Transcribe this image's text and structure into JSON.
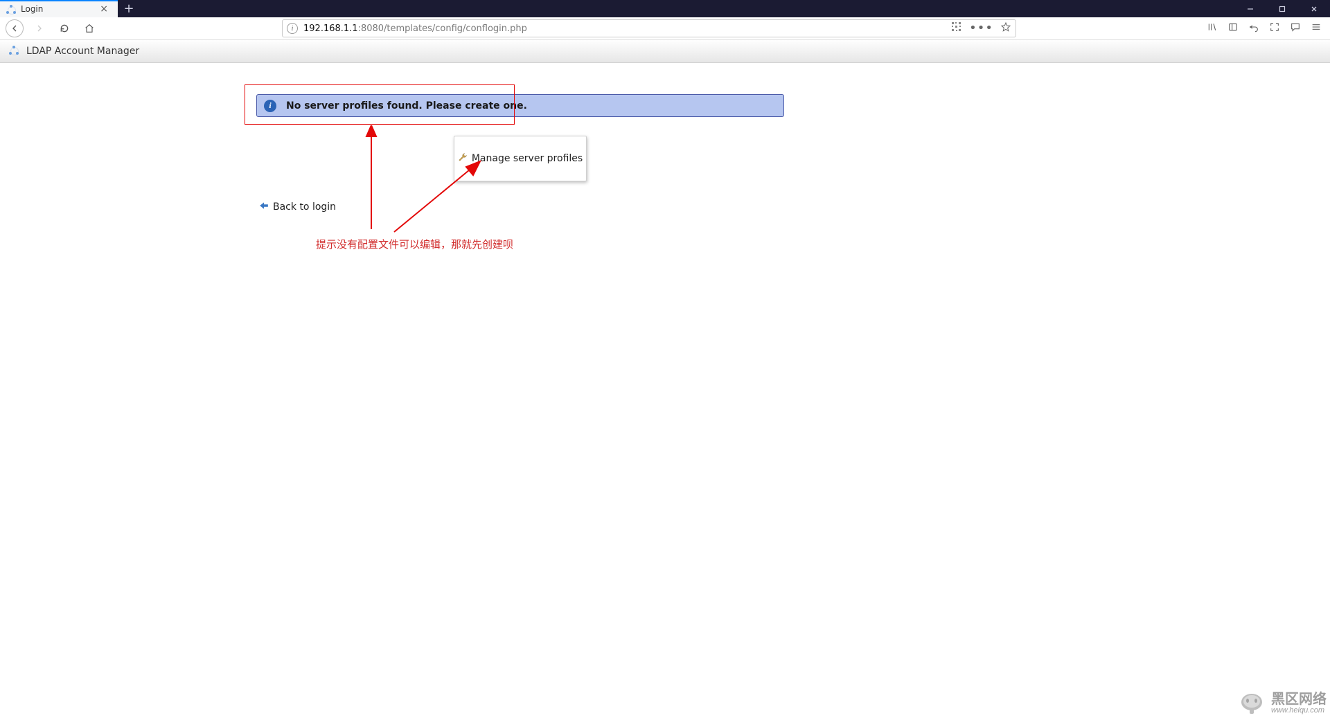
{
  "browser": {
    "tab_title": "Login",
    "url_host": "192.168.1.1",
    "url_rest": ":8080/templates/config/conflogin.php"
  },
  "page": {
    "app_title": "LDAP Account Manager",
    "notice_text": "No server profiles found. Please create one.",
    "manage_profiles_label": "Manage server profiles",
    "back_to_login_label": "Back to login",
    "annotation_text": "提示没有配置文件可以编辑，那就先创建呗"
  },
  "watermark": {
    "name_cn": "黑区网络",
    "url": "www.heiqu.com"
  }
}
